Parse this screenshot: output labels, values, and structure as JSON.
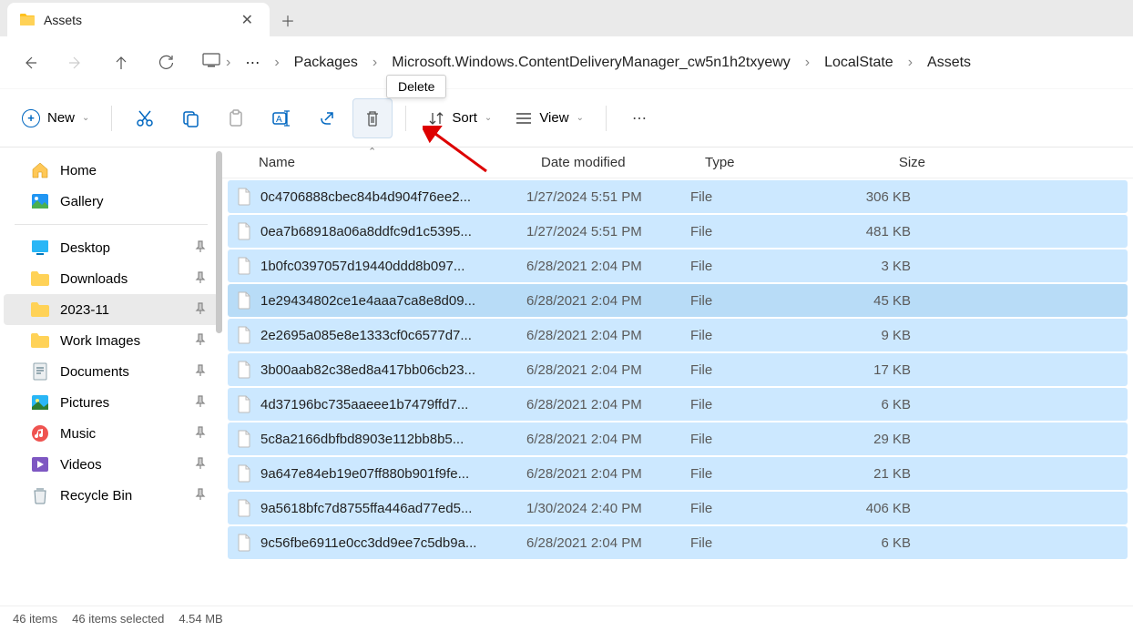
{
  "tab": {
    "title": "Assets"
  },
  "tooltip": "Delete",
  "breadcrumbs": [
    "Packages",
    "Microsoft.Windows.ContentDeliveryManager_cw5n1h2txyewy",
    "LocalState",
    "Assets"
  ],
  "toolbar": {
    "new_label": "New",
    "sort_label": "Sort",
    "view_label": "View"
  },
  "sidebar": {
    "quick": [
      {
        "label": "Home",
        "icon": "home"
      },
      {
        "label": "Gallery",
        "icon": "gallery"
      }
    ],
    "items": [
      {
        "label": "Desktop",
        "icon": "desktop",
        "pinned": true
      },
      {
        "label": "Downloads",
        "icon": "folder",
        "pinned": true
      },
      {
        "label": "2023-11",
        "icon": "folder",
        "pinned": true,
        "selected": true
      },
      {
        "label": "Work Images",
        "icon": "folder",
        "pinned": true
      },
      {
        "label": "Documents",
        "icon": "documents",
        "pinned": true
      },
      {
        "label": "Pictures",
        "icon": "pictures",
        "pinned": true
      },
      {
        "label": "Music",
        "icon": "music",
        "pinned": true
      },
      {
        "label": "Videos",
        "icon": "videos",
        "pinned": true
      },
      {
        "label": "Recycle Bin",
        "icon": "recycle",
        "pinned": true
      }
    ]
  },
  "columns": {
    "name": "Name",
    "date": "Date modified",
    "type": "Type",
    "size": "Size"
  },
  "files": [
    {
      "name": "0c4706888cbec84b4d904f76ee2...",
      "date": "1/27/2024 5:51 PM",
      "type": "File",
      "size": "306 KB"
    },
    {
      "name": "0ea7b68918a06a8ddfc9d1c5395...",
      "date": "1/27/2024 5:51 PM",
      "type": "File",
      "size": "481 KB"
    },
    {
      "name": "1b0fc0397057d19440ddd8b097...",
      "date": "6/28/2021 2:04 PM",
      "type": "File",
      "size": "3 KB"
    },
    {
      "name": "1e29434802ce1e4aaa7ca8e8d09...",
      "date": "6/28/2021 2:04 PM",
      "type": "File",
      "size": "45 KB",
      "hover": true
    },
    {
      "name": "2e2695a085e8e1333cf0c6577d7...",
      "date": "6/28/2021 2:04 PM",
      "type": "File",
      "size": "9 KB"
    },
    {
      "name": "3b00aab82c38ed8a417bb06cb23...",
      "date": "6/28/2021 2:04 PM",
      "type": "File",
      "size": "17 KB"
    },
    {
      "name": "4d37196bc735aaeee1b7479ffd7...",
      "date": "6/28/2021 2:04 PM",
      "type": "File",
      "size": "6 KB"
    },
    {
      "name": "5c8a2166dbfbd8903e112bb8b5...",
      "date": "6/28/2021 2:04 PM",
      "type": "File",
      "size": "29 KB"
    },
    {
      "name": "9a647e84eb19e07ff880b901f9fe...",
      "date": "6/28/2021 2:04 PM",
      "type": "File",
      "size": "21 KB"
    },
    {
      "name": "9a5618bfc7d8755ffa446ad77ed5...",
      "date": "1/30/2024 2:40 PM",
      "type": "File",
      "size": "406 KB"
    },
    {
      "name": "9c56fbe6911e0cc3dd9ee7c5db9a...",
      "date": "6/28/2021 2:04 PM",
      "type": "File",
      "size": "6 KB"
    }
  ],
  "status": {
    "total": "46 items",
    "selected": "46 items selected",
    "size": "4.54 MB"
  }
}
